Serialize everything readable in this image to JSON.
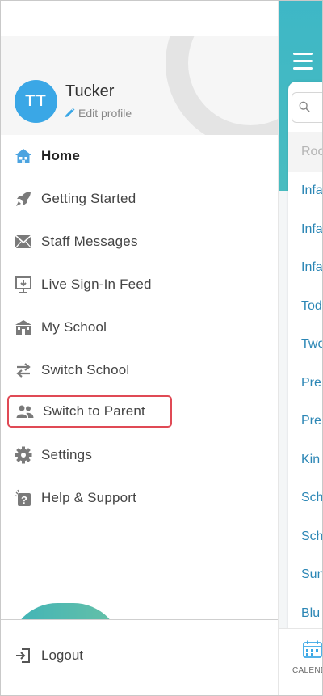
{
  "user": {
    "initials": "TT",
    "name": "Tucker",
    "edit_label": "Edit profile"
  },
  "menu": {
    "items": [
      {
        "label": "Home",
        "icon": "home-icon"
      },
      {
        "label": "Getting Started",
        "icon": "rocket-icon"
      },
      {
        "label": "Staff Messages",
        "icon": "envelope-icon"
      },
      {
        "label": "Live Sign-In Feed",
        "icon": "feed-icon"
      },
      {
        "label": "My School",
        "icon": "school-icon"
      },
      {
        "label": "Switch School",
        "icon": "swap-arrows-icon"
      },
      {
        "label": "Switch to Parent",
        "icon": "users-icon"
      },
      {
        "label": "Settings",
        "icon": "gear-icon"
      },
      {
        "label": "Help & Support",
        "icon": "help-icon"
      }
    ],
    "active": "Home",
    "highlighted": "Switch to Parent"
  },
  "logout_label": "Logout",
  "background_app": {
    "search_placeholder": "Roo",
    "rooms": [
      "Infa",
      "Infa",
      "Infa",
      "Tod",
      "Two",
      "Pre",
      "Pre",
      "Kin",
      "Sch",
      "Sch",
      "Sun",
      "Blu"
    ],
    "tab_label": "CALEND"
  },
  "colors": {
    "accent": "#3aa7e6",
    "teal": "#3eb7c6",
    "highlight_border": "#e04a55",
    "link": "#2b86b5"
  }
}
